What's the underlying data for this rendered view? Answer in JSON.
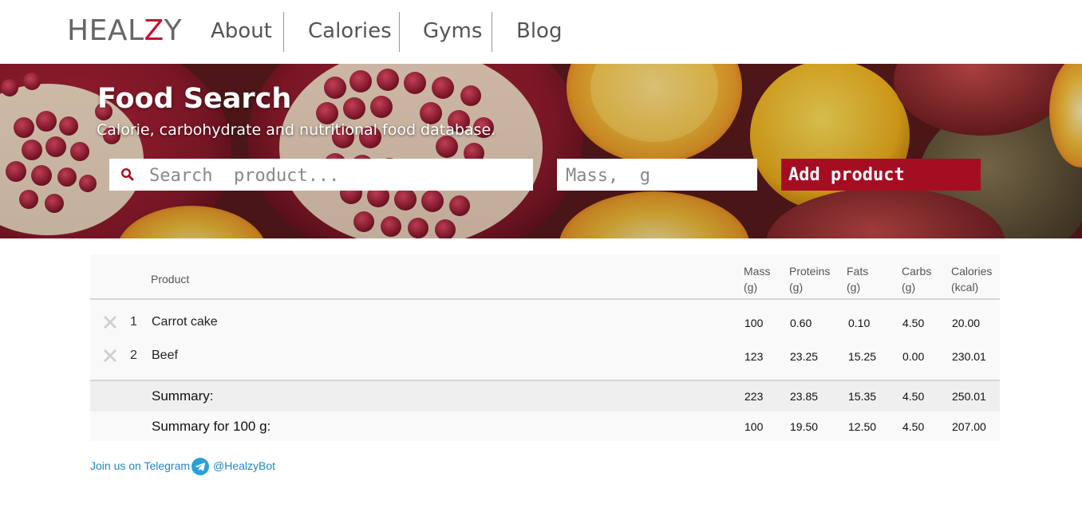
{
  "brand": {
    "logo_pre": "HEAL",
    "logo_z": "Z",
    "logo_post": "Y",
    "accent": "#c8102e"
  },
  "nav": {
    "items": [
      "About",
      "Calories",
      "Gyms",
      "Blog"
    ]
  },
  "hero": {
    "title": "Food Search",
    "subtitle": "Calorie, carbohydrate and nutritional food database.",
    "search_placeholder": "Search  product...",
    "mass_placeholder": "Mass,  g",
    "add_button": "Add  product",
    "button_color": "#a50e22"
  },
  "table": {
    "headers": {
      "product": "Product",
      "mass": [
        "Mass",
        "(g)"
      ],
      "proteins": [
        "Proteins",
        "(g)"
      ],
      "fats": [
        "Fats",
        "(g)"
      ],
      "carbs": [
        "Carbs",
        "(g)"
      ],
      "calories": [
        "Calories",
        "(kcal)"
      ]
    },
    "rows": [
      {
        "num": "1",
        "product": "Carrot cake",
        "mass": "100",
        "proteins": "0.60",
        "fats": "0.10",
        "carbs": "4.50",
        "calories": "20.00"
      },
      {
        "num": "2",
        "product": "Beef",
        "mass": "123",
        "proteins": "23.25",
        "fats": "15.25",
        "carbs": "0.00",
        "calories": "230.01"
      }
    ],
    "summary": {
      "label": "Summary:",
      "mass": "223",
      "proteins": "23.85",
      "fats": "15.35",
      "carbs": "4.50",
      "calories": "250.01"
    },
    "summary100": {
      "label": "Summary for 100 g:",
      "mass": "100",
      "proteins": "19.50",
      "fats": "12.50",
      "carbs": "4.50",
      "calories": "207.00"
    }
  },
  "footer": {
    "join_text": "Join us on Telegram",
    "handle": "@HealzyBot",
    "telegram_icon": "telegram-icon"
  }
}
